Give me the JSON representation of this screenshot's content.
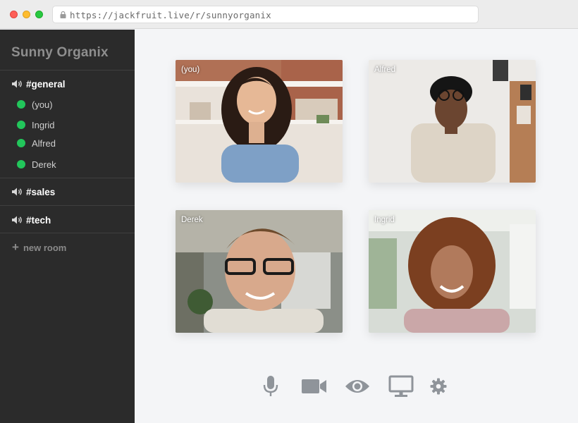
{
  "browser": {
    "url": "https://jackfruit.live/r/sunnyorganix"
  },
  "sidebar": {
    "brand": "Sunny Organix",
    "rooms": [
      {
        "label": "#general",
        "active": true,
        "members": [
          "(you)",
          "Ingrid",
          "Alfred",
          "Derek"
        ]
      },
      {
        "label": "#sales",
        "active": false,
        "members": []
      },
      {
        "label": "#tech",
        "active": false,
        "members": []
      }
    ],
    "new_room_label": "new room",
    "member_status_color": "#22c65b"
  },
  "tiles": [
    {
      "name": "(you)"
    },
    {
      "name": "Alfred"
    },
    {
      "name": "Derek"
    },
    {
      "name": "Ingrid"
    }
  ],
  "controls": {
    "icons": [
      "microphone-icon",
      "camera-icon",
      "eye-icon",
      "screen-share-icon",
      "settings-icon"
    ],
    "icon_color": "#8f949a"
  },
  "colors": {
    "sidebar_bg": "#2b2b2b",
    "content_bg": "#f4f5f7",
    "online": "#22c65b"
  }
}
